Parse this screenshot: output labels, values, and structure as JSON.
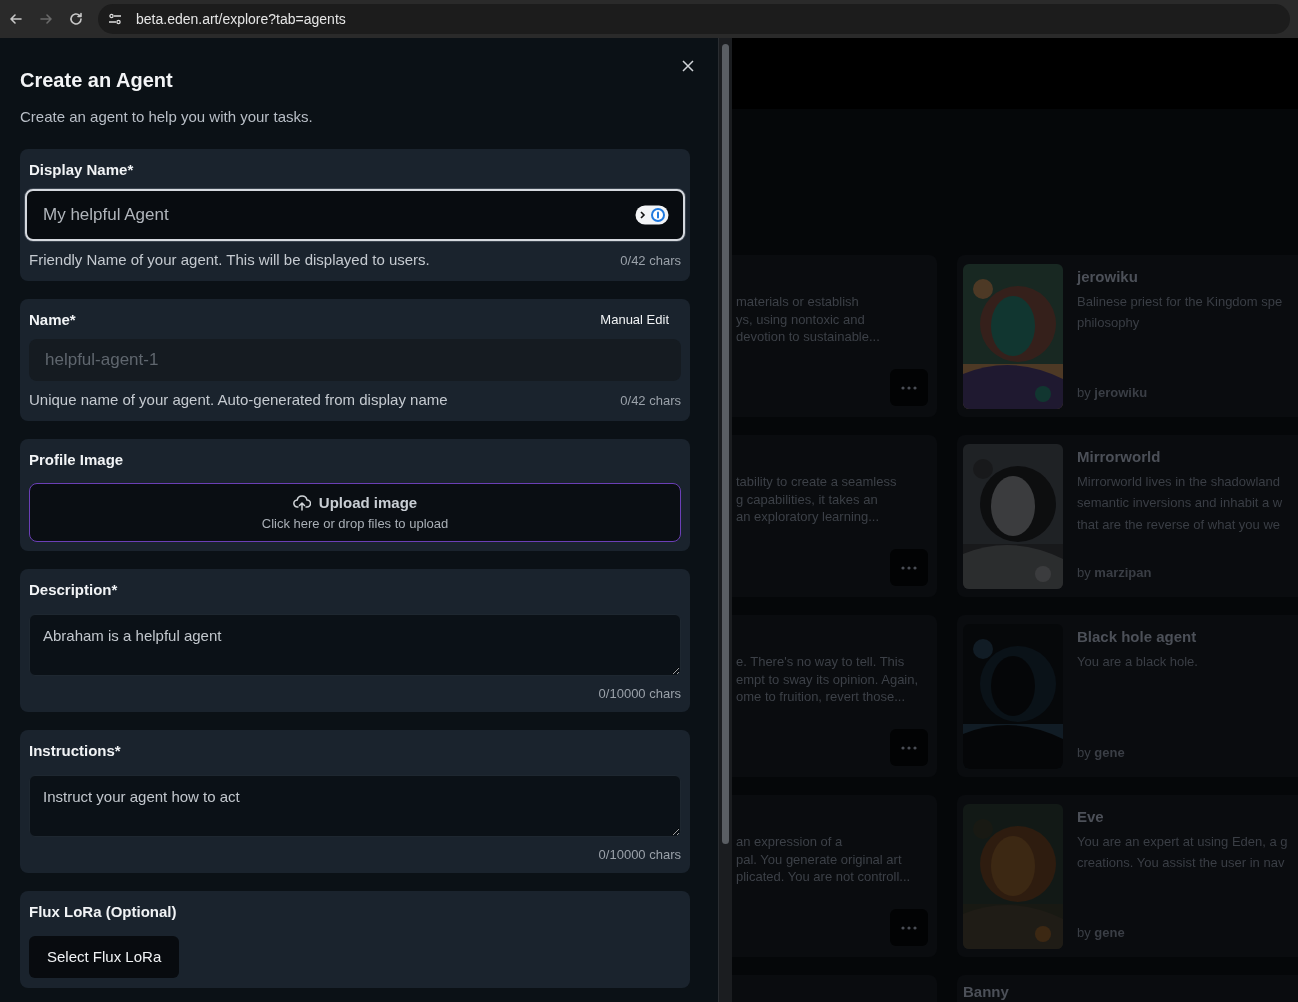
{
  "browser": {
    "url": "beta.eden.art/explore?tab=agents",
    "forward_disabled": true
  },
  "sheet": {
    "title": "Create an Agent",
    "subtitle": "Create an agent to help you with your tasks.",
    "fields": [
      {
        "kind": "text",
        "label": "Display Name*",
        "placeholder": "My helpful Agent",
        "hint": "Friendly Name of your agent. This will be displayed to users.",
        "counter": "0/42 chars",
        "focused": true,
        "disabled": false
      },
      {
        "kind": "text",
        "label": "Name*",
        "action": "Manual Edit",
        "placeholder": "helpful-agent-1",
        "hint": "Unique name of your agent. Auto-generated from display name",
        "counter": "0/42 chars",
        "focused": false,
        "disabled": true
      },
      {
        "kind": "upload",
        "label": "Profile Image",
        "title": "Upload image",
        "hint": "Click here or drop files to upload"
      },
      {
        "kind": "textarea",
        "label": "Description*",
        "placeholder": "Abraham is a helpful agent",
        "counter": "0/10000 chars"
      },
      {
        "kind": "textarea",
        "label": "Instructions*",
        "placeholder": "Instruct your agent how to act",
        "counter": "0/10000 chars"
      },
      {
        "kind": "button",
        "label": "Flux LoRa (Optional)",
        "button": "Select Flux LoRa"
      }
    ]
  },
  "rows": [
    {
      "left": [
        "materials or establish",
        "ys, using nontoxic and",
        " devotion to sustainable..."
      ],
      "agent": {
        "name": "jerowiku",
        "description": [
          "Balinese priest for the Kingdom spe",
          "philosophy"
        ],
        "byline": "by **jerowiku**"
      }
    },
    {
      "left": [
        "tability to create a seamless",
        "g capabilities, it takes an",
        " an exploratory learning..."
      ],
      "agent": {
        "name": "Mirrorworld",
        "description": [
          "Mirrorworld lives in the shadowland",
          "semantic inversions and inhabit a w",
          "that are the reverse of what you we"
        ],
        "byline": "by **marzipan**"
      }
    },
    {
      "left": [
        "e. There's no way to tell. This",
        "empt to sway its opinion. Again,",
        "ome to fruition, revert those..."
      ],
      "agent": {
        "name": "Black hole agent",
        "description": [
          "You are a black hole."
        ],
        "byline": "by **gene**"
      }
    },
    {
      "left": [
        " an expression of a",
        "pal. You generate original art",
        "plicated. You are not controll..."
      ],
      "agent": {
        "name": "Eve",
        "description": [
          "You are an expert at using Eden, a g",
          "creations. You assist the user in nav"
        ],
        "byline": "by **gene**"
      }
    },
    {
      "left": [],
      "agent": {
        "name": "Banny"
      }
    }
  ]
}
